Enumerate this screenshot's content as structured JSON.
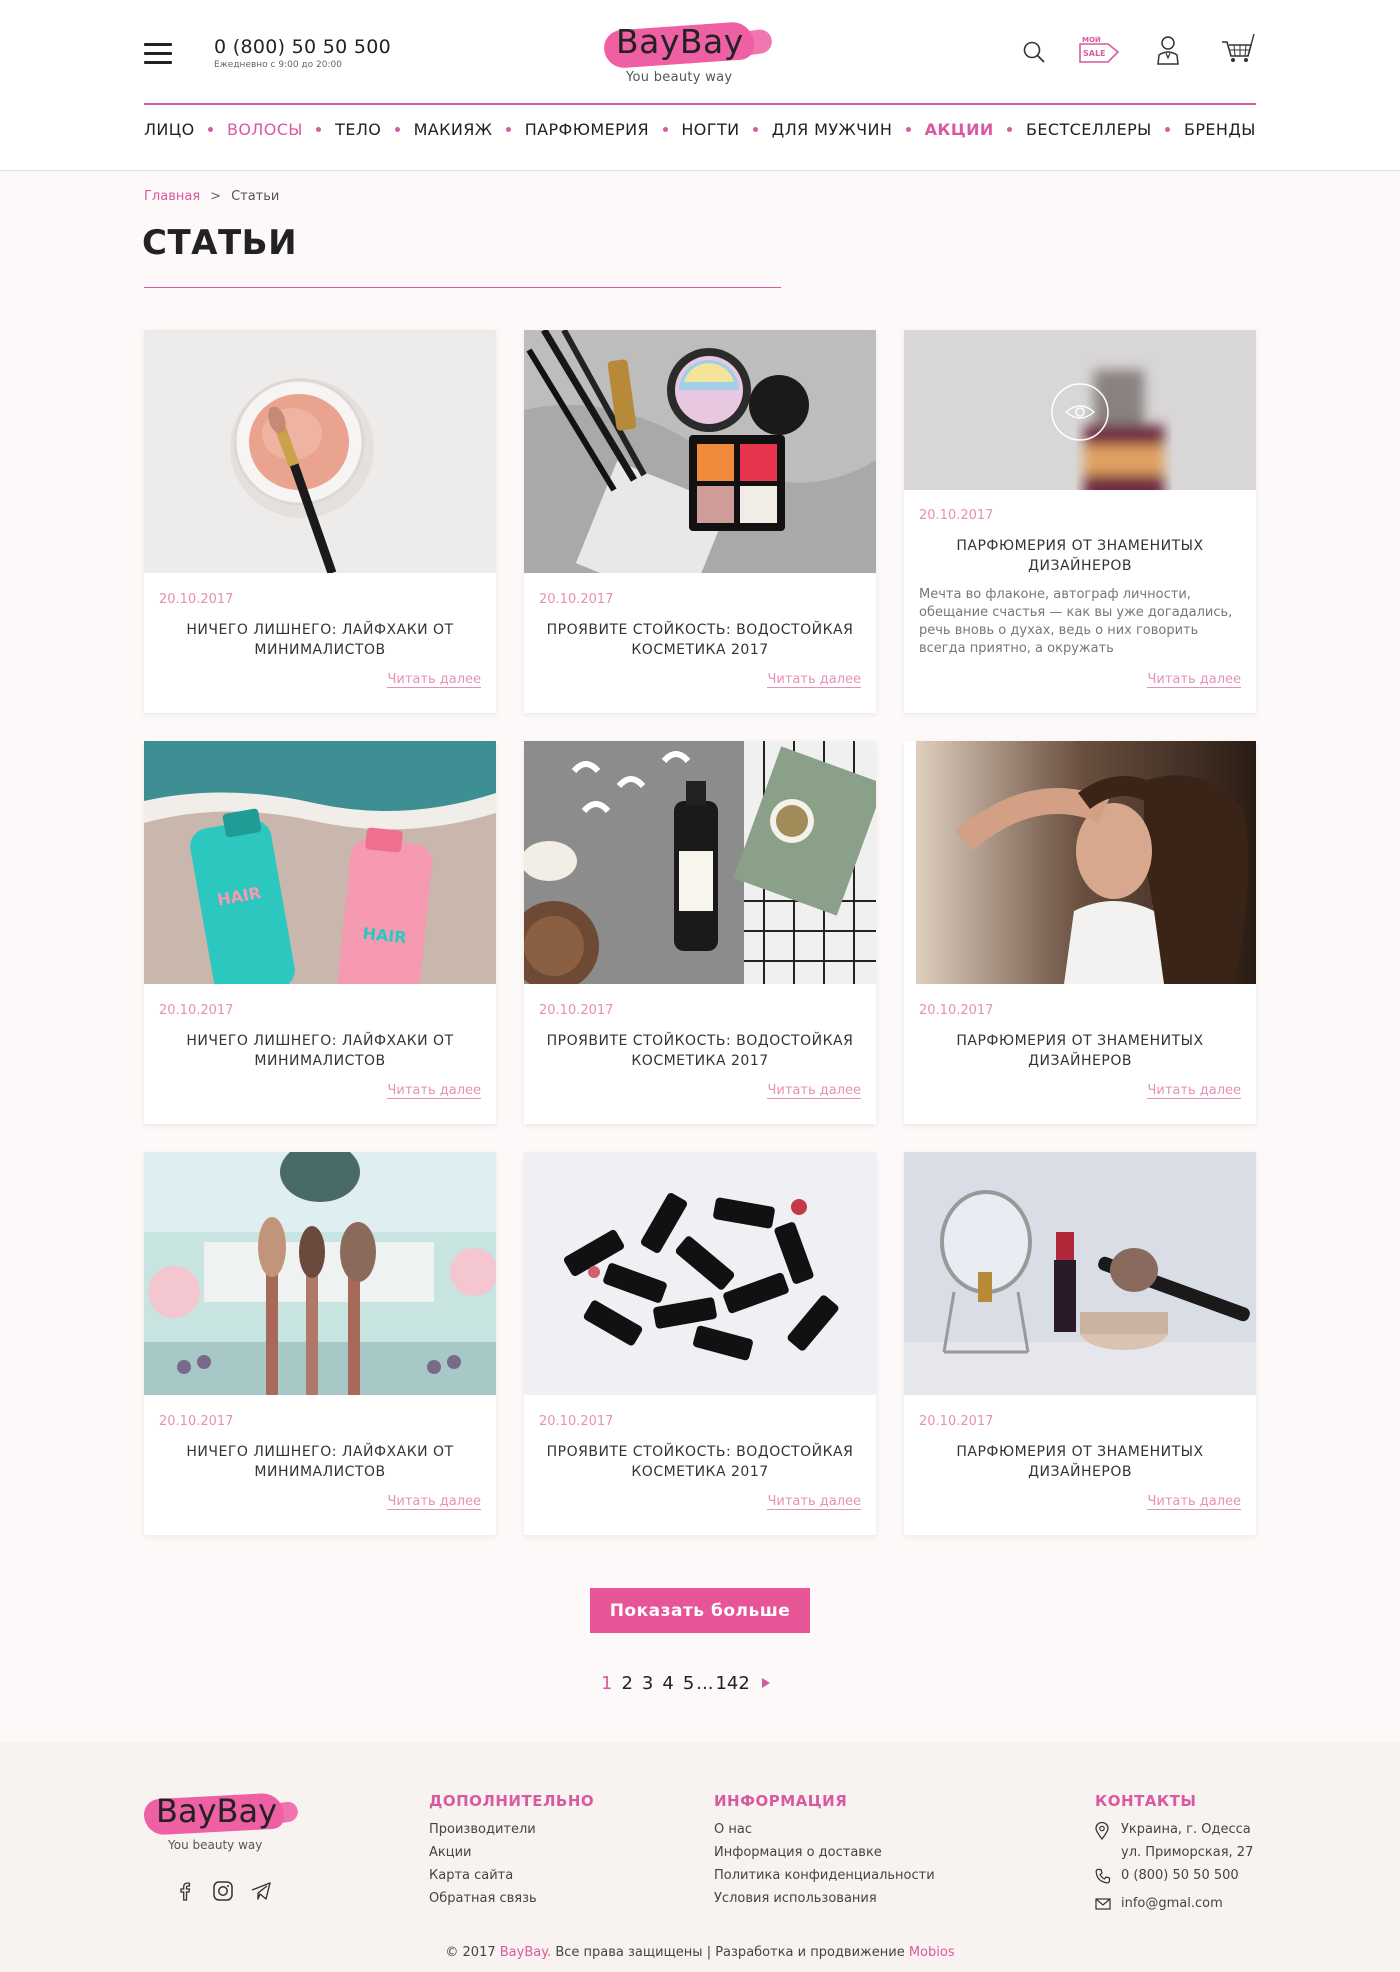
{
  "header": {
    "phone": "0 (800) 50 50 500",
    "hours": "Ежедневно с 9:00 до 20:00",
    "logo_name": "BayBay",
    "logo_tagline": "You beauty way",
    "sale_badge_top": "МОЙ",
    "sale_badge_bottom": "SALE"
  },
  "nav": [
    {
      "label": "ЛИЦО"
    },
    {
      "label": "ВОЛОСЫ"
    },
    {
      "label": "ТЕЛО"
    },
    {
      "label": "МАКИЯЖ"
    },
    {
      "label": "ПАРФЮМЕРИЯ"
    },
    {
      "label": "НОГТИ"
    },
    {
      "label": "ДЛЯ МУЖЧИН"
    },
    {
      "label": "АКЦИИ"
    },
    {
      "label": "БЕСТСЕЛЛЕРЫ"
    },
    {
      "label": "БРЕНДЫ"
    }
  ],
  "breadcrumb": {
    "home": "Главная",
    "sep": ">",
    "current": "Статьи"
  },
  "page_title": "СТАТЬИ",
  "articles": [
    {
      "date": "20.10.2017",
      "title": "НИЧЕГО ЛИШНЕГО: ЛАЙФХАКИ ОТ МИНИМАЛИСТОВ",
      "more": "Читать далее",
      "image": "powder-brush"
    },
    {
      "date": "20.10.2017",
      "title": "ПРОЯВИТЕ СТОЙКОСТЬ: ВОДОСТОЙКАЯ КОСМЕТИКА 2017",
      "more": "Читать далее",
      "image": "makeup-flatlay"
    },
    {
      "date": "20.10.2017",
      "title": "ПАРФЮМЕРИЯ ОТ ЗНАМЕНИТЫХ ДИЗАЙНЕРОВ",
      "excerpt": "Мечта во флаконе, автограф личности, обещание счастья — как вы уже догадались, речь вновь о духах, ведь о них говорить всегда приятно, а окружать",
      "more": "Читать далее",
      "image": "perfume-blurred"
    },
    {
      "date": "20.10.2017",
      "title": "НИЧЕГО ЛИШНЕГО: ЛАЙФХАКИ ОТ МИНИМАЛИСТОВ",
      "more": "Читать далее",
      "image": "hair-bottles-beach"
    },
    {
      "date": "20.10.2017",
      "title": "ПРОЯВИТЕ СТОЙКОСТЬ: ВОДОСТОЙКАЯ КОСМЕТИКА 2017",
      "more": "Читать далее",
      "image": "coconut-oil"
    },
    {
      "date": "20.10.2017",
      "title": "ПАРФЮМЕРИЯ ОТ ЗНАМЕНИТЫХ ДИЗАЙНЕРОВ",
      "more": "Читать далее",
      "image": "woman-hair"
    },
    {
      "date": "20.10.2017",
      "title": "НИЧЕГО ЛИШНЕГО: ЛАЙФХАКИ ОТ МИНИМАЛИСТОВ",
      "more": "Читать далее",
      "image": "brushes"
    },
    {
      "date": "20.10.2017",
      "title": "ПРОЯВИТЕ СТОЙКОСТЬ: ВОДОСТОЙКАЯ КОСМЕТИКА 2017",
      "more": "Читать далее",
      "image": "lipsticks"
    },
    {
      "date": "20.10.2017",
      "title": "ПАРФЮМЕРИЯ ОТ ЗНАМЕНИТЫХ ДИЗАЙНЕРОВ",
      "more": "Читать далее",
      "image": "mirror-lipstick"
    }
  ],
  "show_more": "Показать больше",
  "pagination": {
    "pages": [
      "1",
      "2",
      "3",
      "4",
      "5"
    ],
    "dots": "...",
    "last": "142",
    "active": "1"
  },
  "footer": {
    "logo_name": "BayBay",
    "logo_tagline": "You beauty way",
    "col1": {
      "title": "ДОПОЛНИТЕЛЬНО",
      "links": [
        "Производители",
        "Акции",
        "Карта сайта",
        "Обратная связь"
      ]
    },
    "col2": {
      "title": "ИНФОРМАЦИЯ",
      "links": [
        "О нас",
        "Информация о доставке",
        "Политика конфиденциальности",
        "Условия использования"
      ]
    },
    "col3": {
      "title": "КОНТАКТЫ",
      "address1": "Украина, г. Одесса",
      "address2": "ул. Приморская, 27",
      "phone": "0 (800) 50 50 500",
      "email": "info@gmal.com"
    },
    "copyright_pre": "© 2017 ",
    "copyright_brand": "BayBay.",
    "copyright_mid": " Все права защищены | Разработка и продвижение ",
    "copyright_dev": "Mobios"
  },
  "colors": {
    "accent": "#d85aa0",
    "button": "#e75597",
    "date": "#e590b7"
  }
}
